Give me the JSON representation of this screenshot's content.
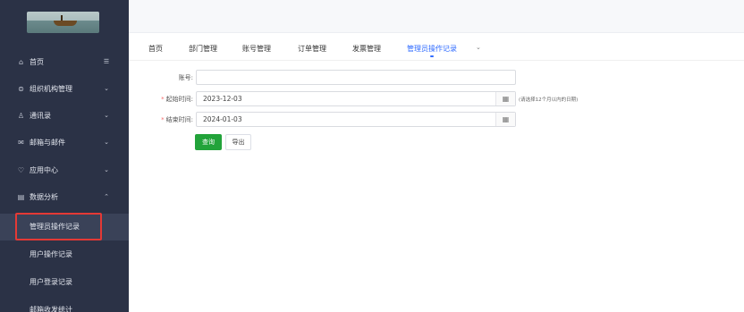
{
  "sidebar": {
    "menu": [
      {
        "label": "首页",
        "icon": "home-icon",
        "glyph": "⌂",
        "arrow": "☰"
      },
      {
        "label": "组织机构管理",
        "icon": "org-icon",
        "glyph": "⊜",
        "arrow": "⌄"
      },
      {
        "label": "通讯录",
        "icon": "contacts-icon",
        "glyph": "♙",
        "arrow": "⌄"
      },
      {
        "label": "邮箱与邮件",
        "icon": "mail-icon",
        "glyph": "✉",
        "arrow": "⌄"
      },
      {
        "label": "应用中心",
        "icon": "apps-icon",
        "glyph": "♡",
        "arrow": "⌄"
      },
      {
        "label": "数据分析",
        "icon": "analysis-icon",
        "glyph": "▤",
        "arrow": "⌃"
      }
    ],
    "submenu": [
      {
        "label": "管理员操作记录"
      },
      {
        "label": "用户操作记录"
      },
      {
        "label": "用户登录记录"
      },
      {
        "label": "邮箱收发统计"
      }
    ]
  },
  "tabs": [
    "首页",
    "部门管理",
    "账号管理",
    "订单管理",
    "发票管理",
    "管理员操作记录"
  ],
  "tab_more_glyph": "⌄",
  "form": {
    "account_label": "账号:",
    "account_value": "",
    "start_label": "起始时间:",
    "start_value": "2023-12-03",
    "end_label": "结束时间:",
    "end_value": "2024-01-03",
    "required_mark": "*",
    "hint": "(请选择12个月以内的日期)",
    "calendar_glyph": "▦"
  },
  "buttons": {
    "query": "查询",
    "export": "导出"
  },
  "colors": {
    "sidebar_bg": "#2b3246",
    "accent": "#2f6bff",
    "primary_button": "#22a33a",
    "highlight_box": "#e53935"
  }
}
